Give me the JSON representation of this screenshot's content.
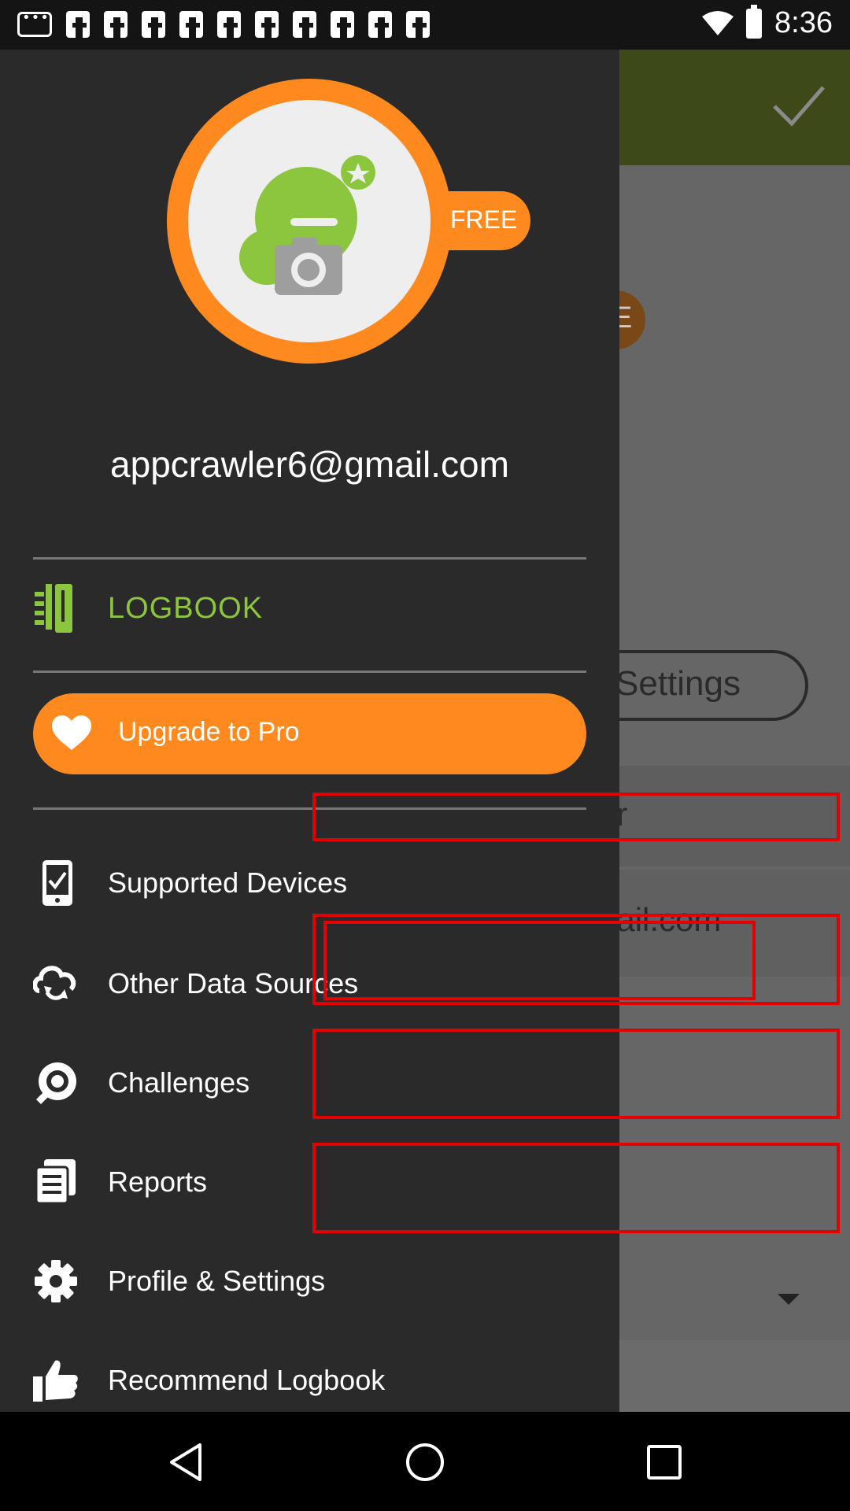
{
  "status_bar": {
    "time": "8:36",
    "icons": [
      "message-icon",
      "facebook-icon",
      "facebook-icon",
      "facebook-icon",
      "facebook-icon",
      "facebook-icon",
      "facebook-icon",
      "facebook-icon",
      "facebook-icon",
      "facebook-icon",
      "facebook-icon",
      "wifi-icon",
      "battery-icon"
    ]
  },
  "background": {
    "pill_text": "E",
    "settings_button": "Settings",
    "row1_text": "er",
    "row2_text": "nail.com",
    "bar_color": "#3d4a17"
  },
  "drawer": {
    "badge": "FREE",
    "email": "appcrawler6@gmail.com",
    "logbook": {
      "label": "LOGBOOK",
      "icon": "logbook-icon"
    },
    "upgrade": {
      "label": "Upgrade to Pro",
      "icon": "heart-icon"
    },
    "items": [
      {
        "label": "Supported Devices",
        "icon": "supported-devices-icon"
      },
      {
        "label": "Other Data Sources",
        "icon": "sync-icon"
      },
      {
        "label": "Challenges",
        "icon": "challenges-icon"
      },
      {
        "label": "Reports",
        "icon": "reports-icon"
      },
      {
        "label": "Profile & Settings",
        "icon": "gear-icon"
      },
      {
        "label": "Recommend Logbook",
        "icon": "thumbs-up-icon"
      }
    ],
    "colors": {
      "accent": "#fe8a1f",
      "logbook_green": "#8cc63e",
      "background": "#2a2a2a"
    }
  },
  "nav_bar": {
    "buttons": [
      "back-icon",
      "home-icon",
      "recents-icon"
    ]
  }
}
